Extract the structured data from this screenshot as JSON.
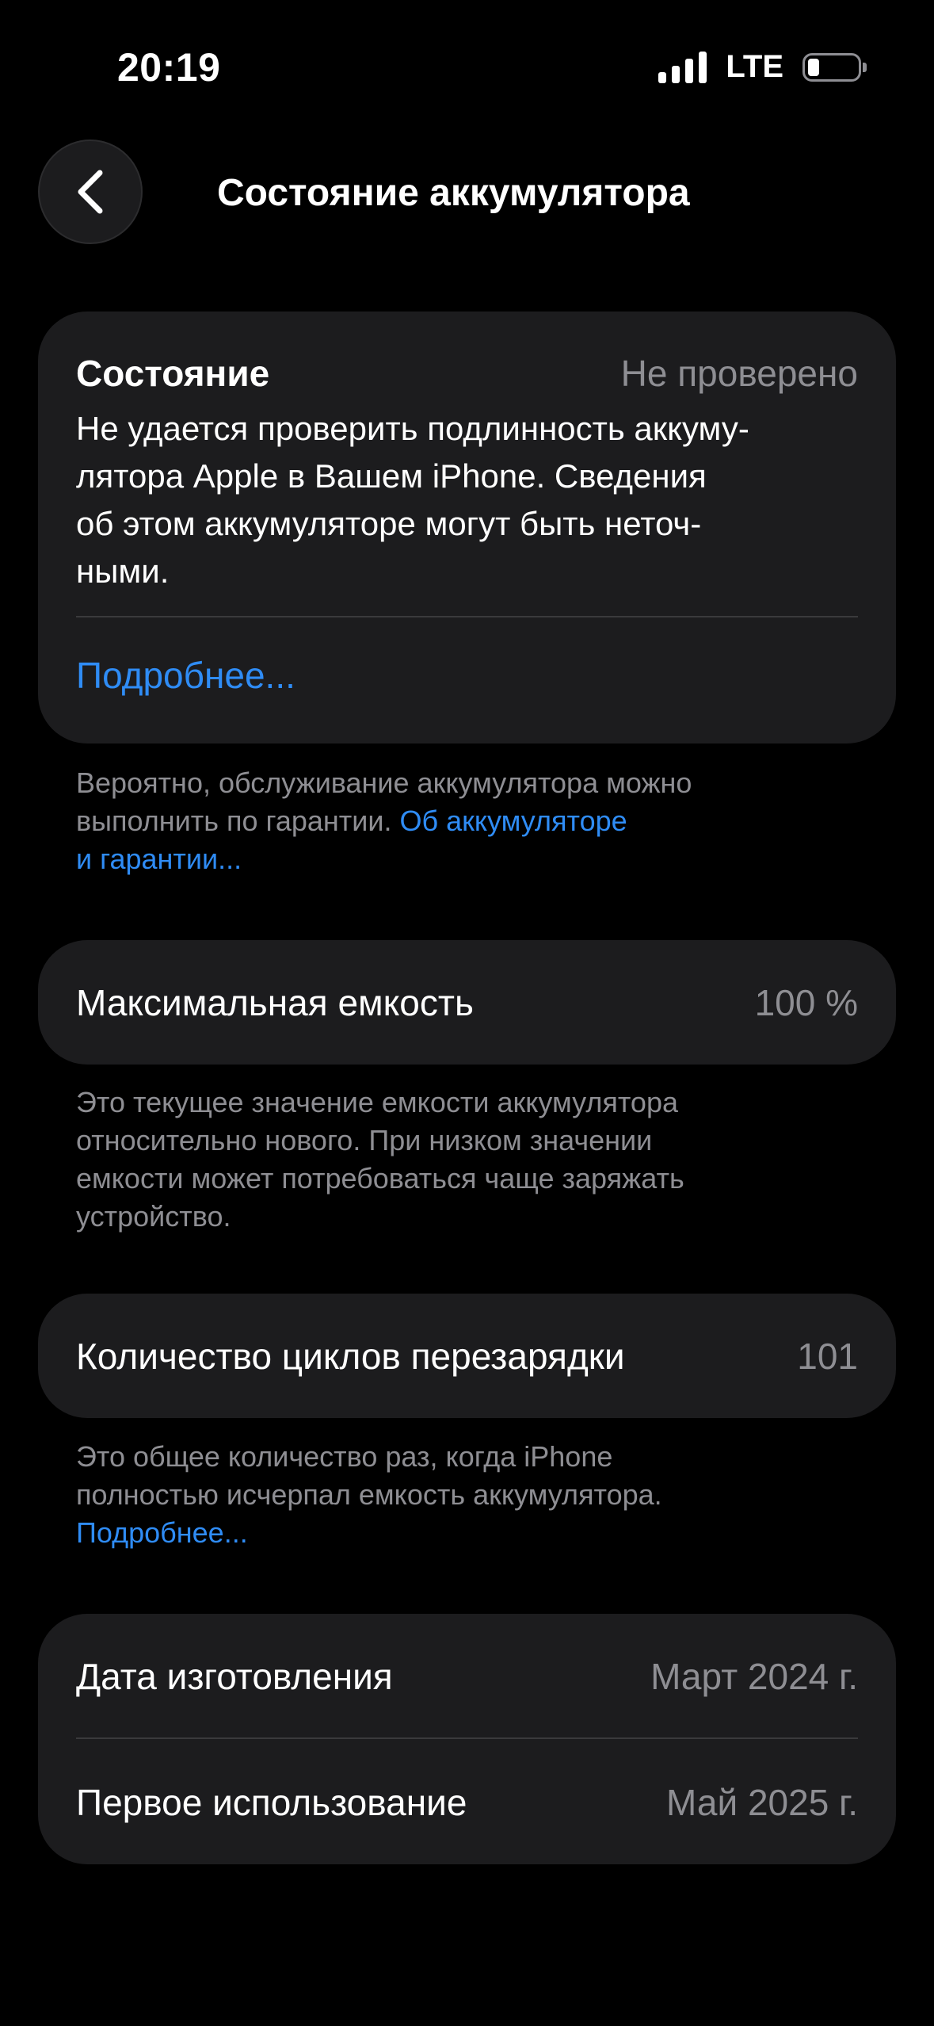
{
  "status_bar": {
    "time": "20:19",
    "network": "LTE"
  },
  "nav": {
    "title": "Состояние аккумулятора"
  },
  "health_card": {
    "label": "Состояние",
    "value": "Не проверено",
    "description_lines": [
      "Не удается проверить подлинность аккуму-",
      "лятора Apple в Вашем iPhone. Сведения",
      "об этом аккумуляторе могут быть неточ-",
      "ными."
    ],
    "link": "Подробнее..."
  },
  "health_footnote": {
    "line1": "Вероятно, обслуживание аккумулятора можно",
    "line2_text": "выполнить по гарантии. ",
    "line2_link": "Об аккумуляторе",
    "line3_link": "и гарантии..."
  },
  "capacity_card": {
    "label": "Максимальная емкость",
    "value": "100 %"
  },
  "capacity_footnote": {
    "lines": [
      "Это текущее значение емкости аккумулятора",
      "относительно нового. При низком значении",
      "емкости может потребоваться чаще заряжать",
      "устройство."
    ]
  },
  "cycles_card": {
    "label": "Количество циклов перезарядки",
    "value": "101"
  },
  "cycles_footnote": {
    "lines": [
      "Это общее количество раз, когда iPhone",
      "полностью исчерпал емкость аккумулятора."
    ],
    "link": "Подробнее..."
  },
  "dates_card": {
    "manufacture_label": "Дата изготовления",
    "manufacture_value": "Март 2024 г.",
    "first_use_label": "Первое использование",
    "first_use_value": "Май 2025 г."
  },
  "colors": {
    "background": "#000000",
    "card": "#1c1c1e",
    "secondary_text": "#8e8e93",
    "link": "#2f8cf5"
  }
}
